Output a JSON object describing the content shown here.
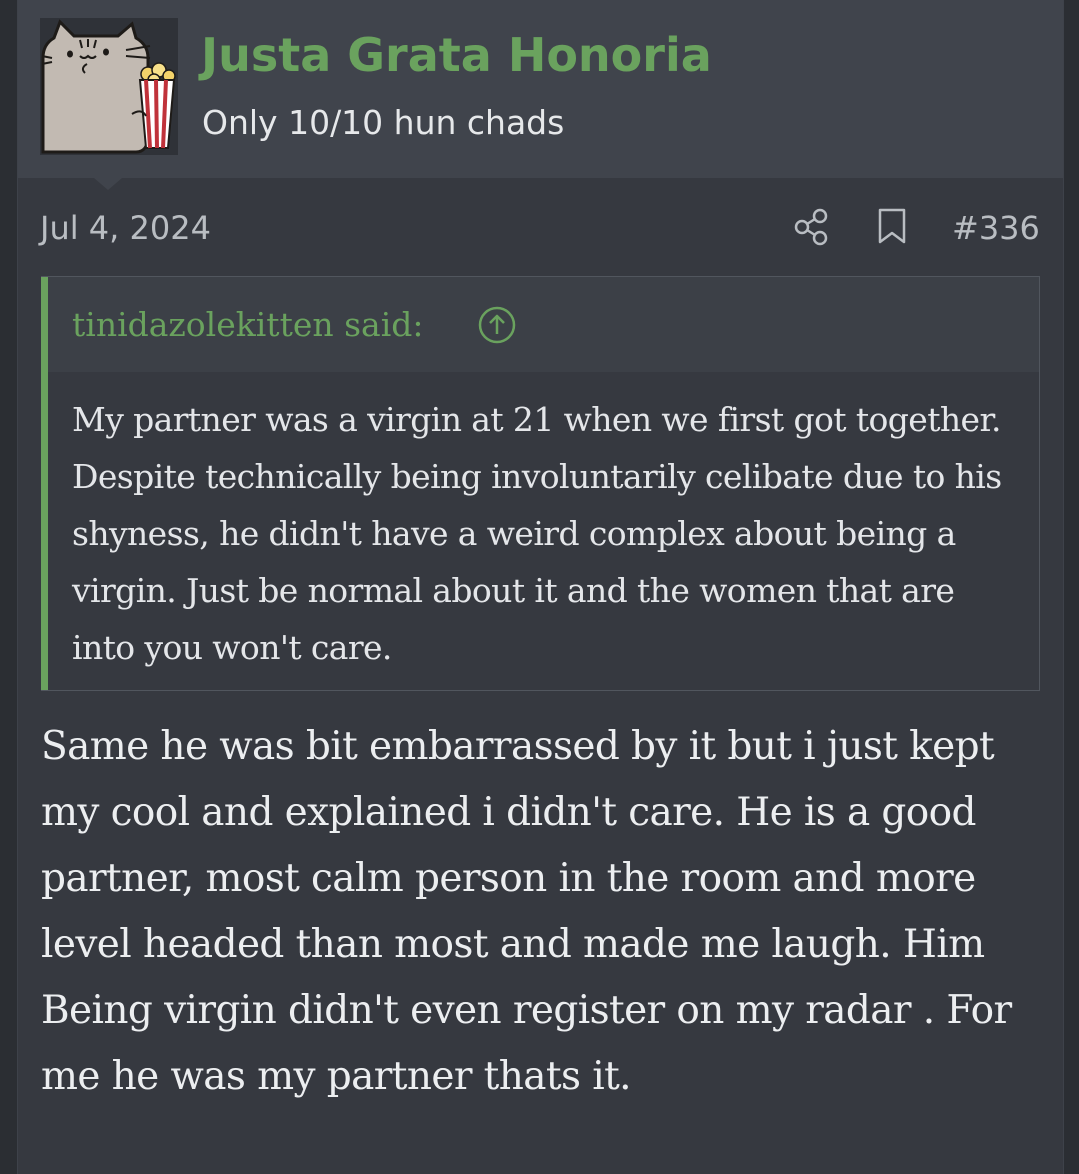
{
  "user": {
    "name": "Justa Grata Honoria",
    "title": "Only 10/10 hun chads"
  },
  "post": {
    "date": "Jul 4, 2024",
    "number": "#336"
  },
  "quote": {
    "author_line": "tinidazolekitten said:",
    "text": "My partner was a virgin at 21 when we first got together. Despite technically being involuntarily celibate due to his shyness, he didn't have a weird complex about being a virgin. Just be normal about it and the women that are into you won't care."
  },
  "message": {
    "text": "Same he was bit embarrassed by it but i just kept my cool and explained i didn't care. He is a good partner, most calm person in the room and more level headed than most and made me laugh. Him Being virgin didn't even register on my radar . For me he was my partner thats it."
  },
  "icons": {
    "share": "share-icon",
    "bookmark": "bookmark-icon",
    "quote_jump": "arrow-up-circle-icon",
    "avatar": "cat-with-popcorn-avatar"
  },
  "colors": {
    "accent": "#6aa25e",
    "background": "#2b2e33",
    "post_background": "#363940",
    "header_background": "#40444c",
    "text": "#eceef0",
    "muted_text": "#b9bdc2"
  }
}
